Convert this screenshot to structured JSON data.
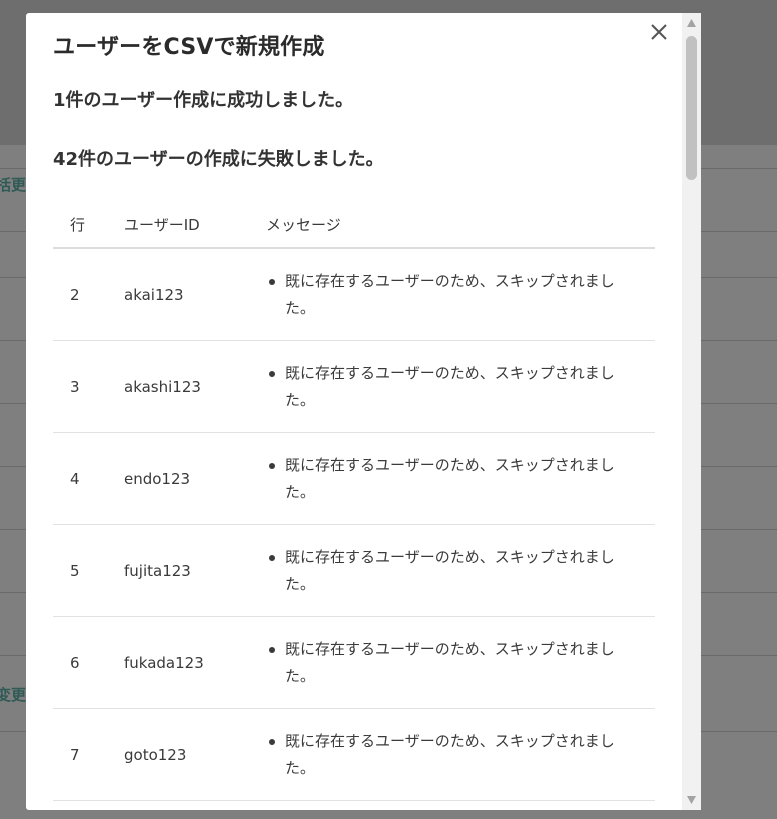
{
  "background": {
    "partial_texts": [
      "一括更",
      "を変更"
    ]
  },
  "modal": {
    "title": "ユーザーをCSVで新規作成",
    "success_message": "1件のユーザー作成に成功しました。",
    "failure_message": "42件のユーザーの作成に失敗しました。",
    "close_icon": "close-icon",
    "table": {
      "headers": [
        "行",
        "ユーザーID",
        "メッセージ"
      ],
      "rows": [
        {
          "row": "2",
          "user_id": "akai123",
          "message": "既に存在するユーザーのため、スキップされました。"
        },
        {
          "row": "3",
          "user_id": "akashi123",
          "message": "既に存在するユーザーのため、スキップされました。"
        },
        {
          "row": "4",
          "user_id": "endo123",
          "message": "既に存在するユーザーのため、スキップされました。"
        },
        {
          "row": "5",
          "user_id": "fujita123",
          "message": "既に存在するユーザーのため、スキップされました。"
        },
        {
          "row": "6",
          "user_id": "fukada123",
          "message": "既に存在するユーザーのため、スキップされました。"
        },
        {
          "row": "7",
          "user_id": "goto123",
          "message": "既に存在するユーザーのため、スキップされました。"
        }
      ]
    }
  },
  "colors": {
    "overlay": "#7a7a7a",
    "modal_bg": "#ffffff",
    "text": "#333333",
    "bg_link": "#2f5a55"
  }
}
